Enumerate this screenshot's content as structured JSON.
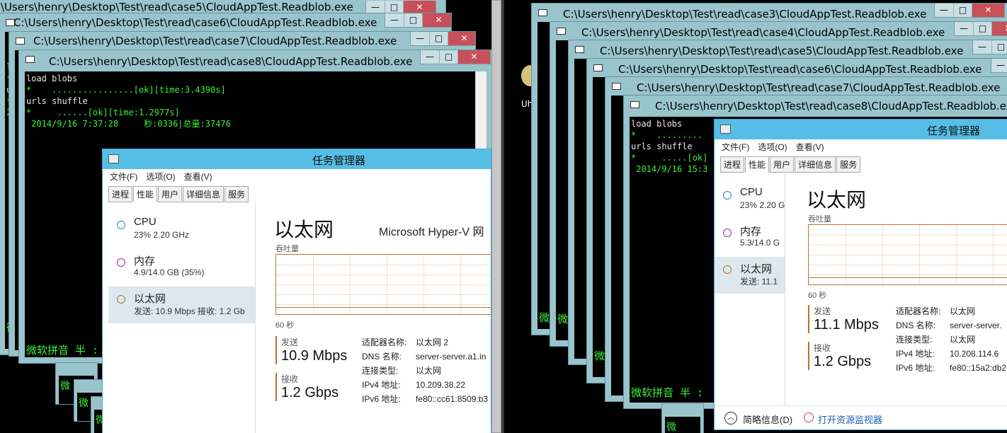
{
  "left": {
    "console_windows": [
      {
        "title": "\\Users\\henry\\Desktop\\Test\\read\\case5\\CloudAppTest.Readblob.exe"
      },
      {
        "title": "C:\\Users\\henry\\Desktop\\Test\\read\\case6\\CloudAppTest.Readblob.exe"
      },
      {
        "title": "C:\\Users\\henry\\Desktop\\Test\\read\\case7\\CloudAppTest.Readblob.exe"
      },
      {
        "title": "C:\\Users\\henry\\Desktop\\Test\\read\\case8\\CloudAppTest.Readblob.exe"
      }
    ],
    "console_lines": [
      "load blobs",
      "*    ................[ok][time:3.4390s]",
      "urls shuffle",
      "*     ......[ok][time:1.2977s]",
      " 2014/9/16 7:37:28     秒:0336|总量:37476"
    ],
    "ime_text": "微软拼音 半 :",
    "side_fragments": [
      "lo",
      "*",
      "ur",
      "*",
      "2"
    ],
    "stub_chars": [
      "微",
      "微",
      "微"
    ],
    "control_glyphs": [
      "—",
      "□",
      "✕"
    ]
  },
  "left_taskmgr": {
    "title": "任务管理器",
    "menu": [
      "文件(F)",
      "选项(O)",
      "查看(V)"
    ],
    "tabs": [
      "进程",
      "性能",
      "用户",
      "详细信息",
      "服务"
    ],
    "active_tab": "性能",
    "items": [
      {
        "name": "CPU",
        "sub": "23%  2.20 GHz",
        "color": "#1e88c8"
      },
      {
        "name": "内存",
        "sub": "4.9/14.0 GB (35%)",
        "color": "#8b2fb0"
      },
      {
        "name": "以太网",
        "sub": "发送: 10.9 Mbps  接收: 1.2 Gb",
        "color": "#b8722c"
      }
    ],
    "heading": "以太网",
    "adapter": "Microsoft Hyper-V 网",
    "throughput_label": "吞吐量",
    "time_label": "60 秒",
    "send_label": "发送",
    "send_value": "10.9 Mbps",
    "recv_label": "接收",
    "recv_value": "1.2 Gbps",
    "details": [
      {
        "k": "适配器名称:",
        "v": "以太网 2"
      },
      {
        "k": "DNS 名称:",
        "v": "server-server.a1.in"
      },
      {
        "k": "连接类型:",
        "v": "以太网"
      },
      {
        "k": "IPv4 地址:",
        "v": "10.209.38.22"
      },
      {
        "k": "IPv6 地址:",
        "v": "fe80::cc61:8509:b3"
      }
    ]
  },
  "right": {
    "console_windows": [
      {
        "title": "C:\\Users\\henry\\Desktop\\Test\\read\\case3\\CloudAppTest.Readblob.exe"
      },
      {
        "title": "C:\\Users\\henry\\Desktop\\Test\\read\\case4\\CloudAppTest.Readblob.exe"
      },
      {
        "title": "C:\\Users\\henry\\Desktop\\Test\\read\\case5\\CloudAppTest.Readblob.exe"
      },
      {
        "title": "C:\\Users\\henry\\Desktop\\Test\\read\\case6\\CloudAppTest.Readblob.exe"
      },
      {
        "title": "C:\\Users\\henry\\Desktop\\Test\\read\\case7\\CloudAppTest.Readblob.exe"
      },
      {
        "title": "C:\\Users\\henry\\Desktop\\Test\\read\\case8\\CloudAppTest.Readblob.exe"
      }
    ],
    "console_lines": [
      "load blobs",
      "*    .........",
      "urls shuffle",
      "*     .....[ok]",
      " 2014/9/16 15:3"
    ],
    "ime_text": "微软拼音 半 :",
    "desktop_label": "Uh",
    "stub_chars": [
      "微",
      "微",
      "微"
    ]
  },
  "right_taskmgr": {
    "title": "任务管理器",
    "menu": [
      "文件(F)",
      "选项(O)",
      "查看(V)"
    ],
    "tabs": [
      "进程",
      "性能",
      "用户",
      "详细信息",
      "服务"
    ],
    "active_tab": "性能",
    "items": [
      {
        "name": "CPU",
        "sub": "23%  2.20 G",
        "color": "#1e88c8"
      },
      {
        "name": "内存",
        "sub": "5.3/14.0 G",
        "color": "#8b2fb0"
      },
      {
        "name": "以太网",
        "sub": "发送: 11.1",
        "color": "#b8722c"
      }
    ],
    "heading": "以太网",
    "throughput_label": "吞吐量",
    "time_label": "60 秒",
    "send_label": "发送",
    "send_value": "11.1 Mbps",
    "recv_label": "接收",
    "recv_value": "1.2 Gbps",
    "details": [
      {
        "k": "适配器名称:",
        "v": "以太网"
      },
      {
        "k": "DNS 名称:",
        "v": "server-server."
      },
      {
        "k": "连接类型:",
        "v": "以太网"
      },
      {
        "k": "IPv4 地址:",
        "v": "10.208.114.6"
      },
      {
        "k": "IPv6 地址:",
        "v": "fe80::15a2:db2"
      }
    ],
    "footer_less": "简略信息(D)",
    "footer_monitor": "打开资源监视器"
  },
  "colors": {
    "console_green": "#3cf03c",
    "window_frame": "#99c4cc",
    "taskmgr_title": "#56bde6",
    "ethernet_line": "#b8722c"
  }
}
